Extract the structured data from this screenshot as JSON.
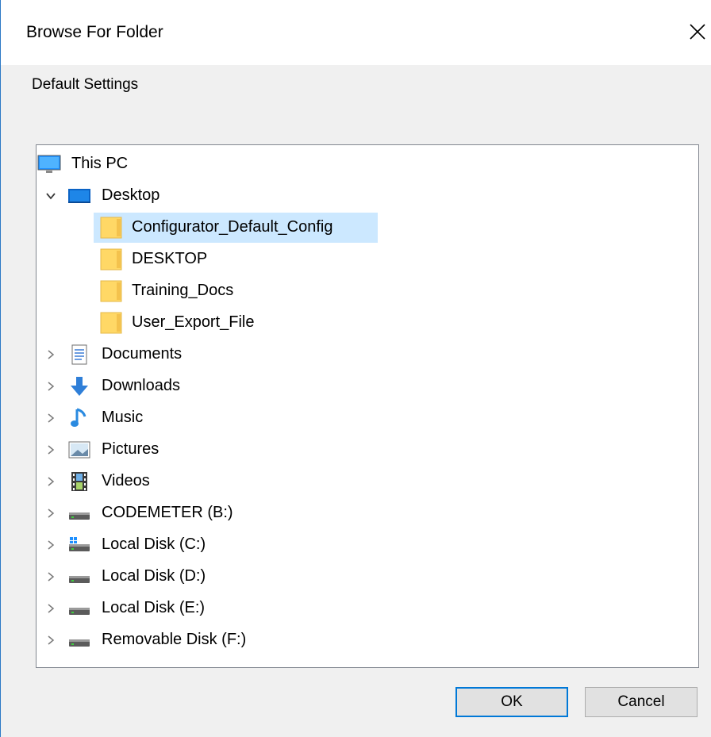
{
  "window": {
    "title": "Browse For Folder",
    "close_icon": "close-icon"
  },
  "description": "Default Settings",
  "tree": {
    "items": [
      {
        "label": "This PC",
        "icon": "computer-icon",
        "level": 0,
        "expander": "none"
      },
      {
        "label": "Desktop",
        "icon": "desktop-icon",
        "level": 1,
        "expander": "expanded"
      },
      {
        "label": "Configurator_Default_Config",
        "icon": "folder-icon",
        "level": 2,
        "expander": "none",
        "selected": true
      },
      {
        "label": "DESKTOP",
        "icon": "folder-icon",
        "level": 2,
        "expander": "none"
      },
      {
        "label": "Training_Docs",
        "icon": "folder-icon",
        "level": 2,
        "expander": "none"
      },
      {
        "label": "User_Export_File",
        "icon": "folder-icon",
        "level": 2,
        "expander": "none"
      },
      {
        "label": "Documents",
        "icon": "documents-icon",
        "level": 1,
        "expander": "collapsed"
      },
      {
        "label": "Downloads",
        "icon": "downloads-icon",
        "level": 1,
        "expander": "collapsed"
      },
      {
        "label": "Music",
        "icon": "music-icon",
        "level": 1,
        "expander": "collapsed"
      },
      {
        "label": "Pictures",
        "icon": "pictures-icon",
        "level": 1,
        "expander": "collapsed"
      },
      {
        "label": "Videos",
        "icon": "videos-icon",
        "level": 1,
        "expander": "collapsed"
      },
      {
        "label": "CODEMETER (B:)",
        "icon": "drive-icon",
        "level": 1,
        "expander": "collapsed"
      },
      {
        "label": "Local Disk (C:)",
        "icon": "system-drive-icon",
        "level": 1,
        "expander": "collapsed"
      },
      {
        "label": "Local Disk (D:)",
        "icon": "drive-icon",
        "level": 1,
        "expander": "collapsed"
      },
      {
        "label": "Local Disk (E:)",
        "icon": "drive-icon",
        "level": 1,
        "expander": "collapsed"
      },
      {
        "label": "Removable Disk (F:)",
        "icon": "drive-icon",
        "level": 1,
        "expander": "collapsed"
      }
    ]
  },
  "buttons": {
    "ok_label": "OK",
    "cancel_label": "Cancel"
  },
  "colors": {
    "selection": "#cce8ff",
    "folder": "#ffd866",
    "accent": "#0078d7"
  }
}
